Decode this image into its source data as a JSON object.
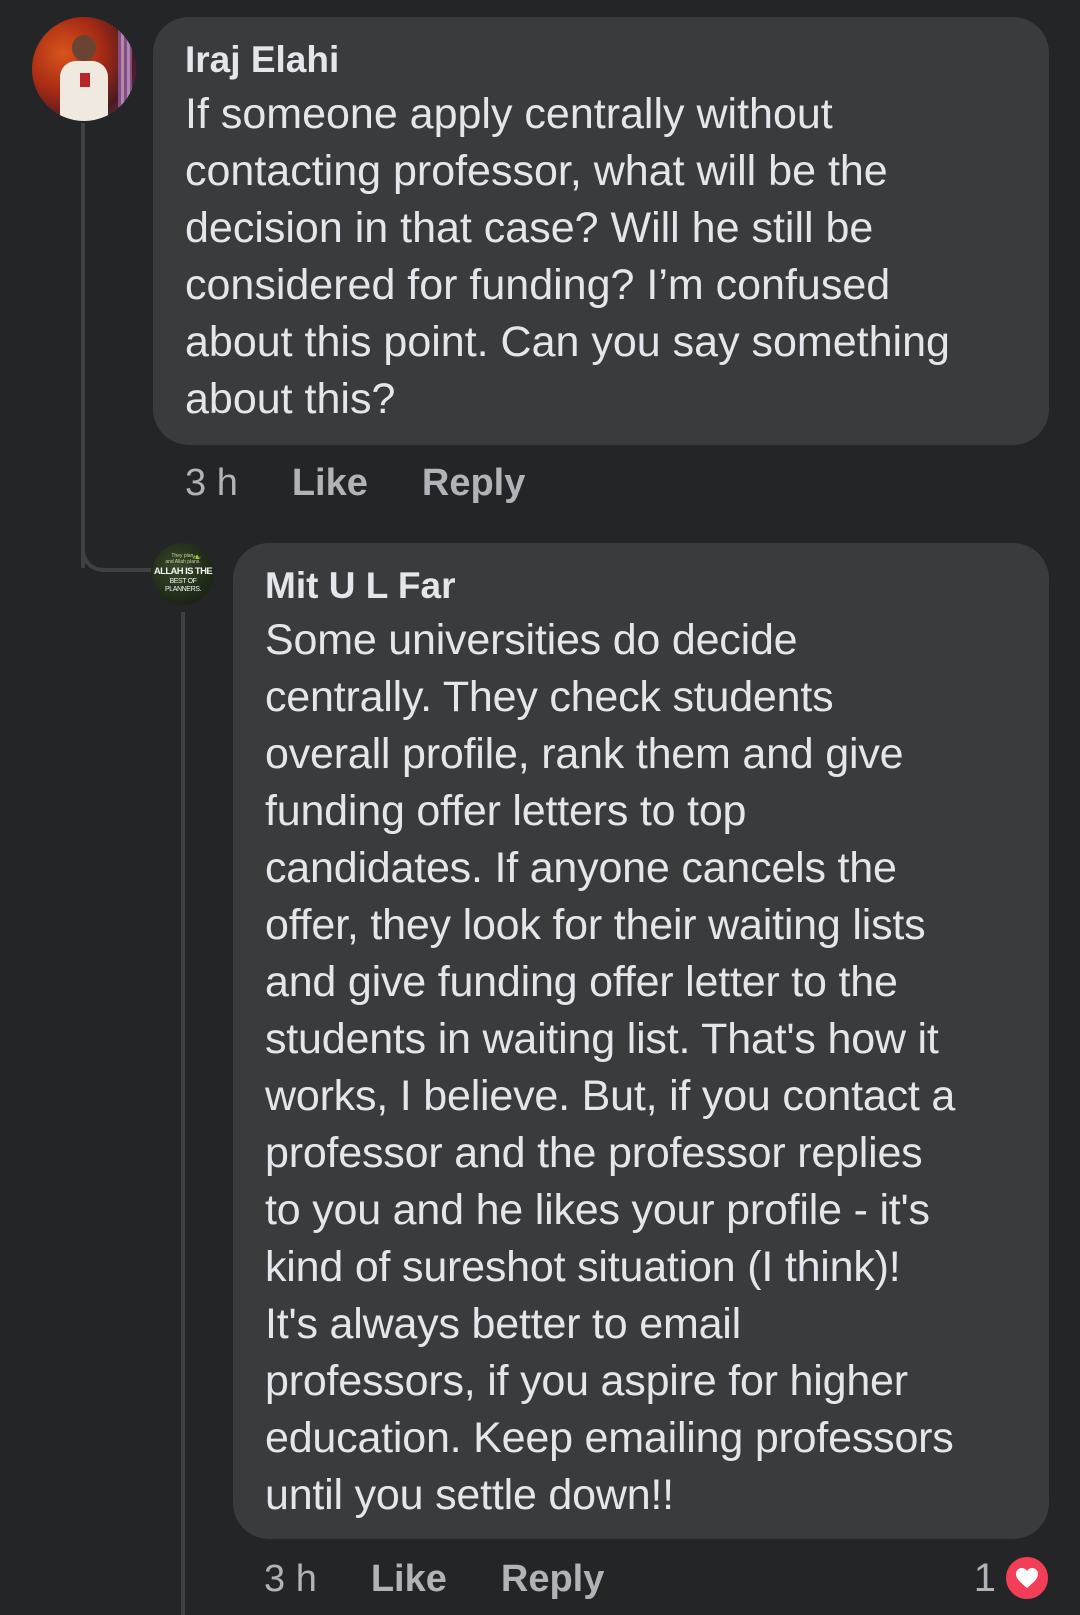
{
  "comments": [
    {
      "author": "Iraj Elahi",
      "text": "If someone apply centrally without\ncontacting professor, what will be the\ndecision in that case? Will he still be\nconsidered for funding? I’m confused\nabout this point. Can you say something\nabout this?",
      "timestamp": "3 h",
      "like_label": "Like",
      "reply_label": "Reply"
    },
    {
      "author": "Mit U L Far",
      "avatar_text": {
        "small": "They plan,\nand Allah plans.",
        "main": "ALLAH IS THE",
        "sub": "BEST OF PLANNERS."
      },
      "text": "Some universities do decide\ncentrally. They check students\noverall profile, rank them and give\nfunding offer letters to top\ncandidates. If anyone cancels the\noffer, they look for their waiting lists\nand give funding offer letter to the\nstudents in waiting list. That's how it\nworks, I believe. But, if you contact a\nprofessor and the professor replies\nto you and he likes your profile - it's\nkind of sureshot situation (I think)!\nIt's always better to email\nprofessors, if you aspire for higher\neducation. Keep emailing professors\nuntil you settle down!!",
      "timestamp": "3 h",
      "like_label": "Like",
      "reply_label": "Reply",
      "reaction_count": "1",
      "reaction_icon": "heart-icon",
      "reaction_color": "#f33e58"
    }
  ],
  "theme": {
    "background": "#242527",
    "bubble": "#3a3b3c",
    "text": "#e4e6eb",
    "secondary_text": "#b0b3b8"
  }
}
